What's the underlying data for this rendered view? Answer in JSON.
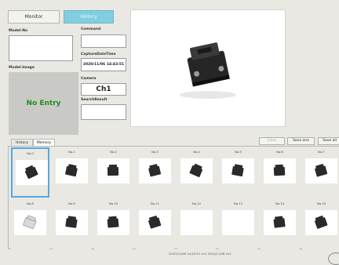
{
  "top": {
    "monitor_label": "Monitor",
    "history_label": "History"
  },
  "left": {
    "model_no_label": "Model-No",
    "model_no_value": "",
    "model_image_label": "Model-Image",
    "no_entry_text": "No Entry"
  },
  "info": {
    "command_label": "Command",
    "command_value": "",
    "capture_label": "CaptureDateTime",
    "capture_value": "2020/11/06 14:43:51",
    "camera_label": "Camera",
    "camera_value": "Ch1",
    "search_label": "SearchResult",
    "search_value": ""
  },
  "tabs": {
    "history": "History",
    "memory": "Memory"
  },
  "actions": {
    "clear": "Clear",
    "save_one": "Save one",
    "save_all": "Save all"
  },
  "grid": {
    "cells": [
      {
        "label": "No.0",
        "thumb": "connector-dark",
        "selected": true
      },
      {
        "label": "No.1",
        "thumb": "connector-dark"
      },
      {
        "label": "No.2",
        "thumb": "connector-dark"
      },
      {
        "label": "No.3",
        "thumb": "connector-dark"
      },
      {
        "label": "No.4",
        "thumb": "connector-dark"
      },
      {
        "label": "No.5",
        "thumb": "connector-dark"
      },
      {
        "label": "No.6",
        "thumb": "connector-dark"
      },
      {
        "label": "No.7",
        "thumb": "connector-dark"
      },
      {
        "label": "No.8",
        "thumb": "connector-light"
      },
      {
        "label": "No.9",
        "thumb": "connector-dark"
      },
      {
        "label": "No.10",
        "thumb": "connector-dark"
      },
      {
        "label": "No.11",
        "thumb": "connector-dark"
      },
      {
        "label": "No.12",
        "thumb": "empty"
      },
      {
        "label": "No.13",
        "thumb": "empty"
      },
      {
        "label": "No.14",
        "thumb": "connector-dark"
      },
      {
        "label": "No.15",
        "thumb": "connector-dark"
      }
    ]
  },
  "status_text": "2020/11/06 14:43:51   ch1   2020/11/06   ch1"
}
